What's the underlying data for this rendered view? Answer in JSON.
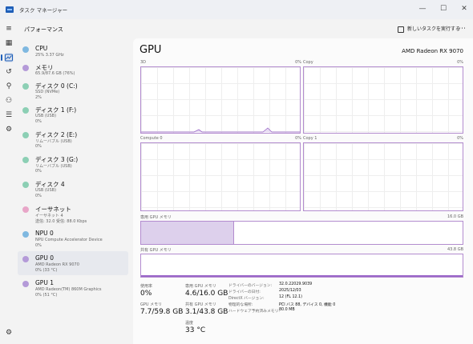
{
  "window": {
    "title": "タスク マネージャー",
    "controls": [
      "—",
      "☐",
      "✕"
    ]
  },
  "header": {
    "page_title": "パフォーマンス",
    "run_task_label": "新しいタスクを実行する",
    "more_label": "⋯"
  },
  "devices": [
    {
      "name": "CPU",
      "s1": "25%  3.37 GHz",
      "s2": "",
      "color": "#7fb8e0"
    },
    {
      "name": "メモリ",
      "s1": "65.9/87.6 GB (76%)",
      "s2": "",
      "color": "#b49ad8"
    },
    {
      "name": "ディスク 0 (C:)",
      "s1": "SSD (NVMe)",
      "s2": "2%",
      "color": "#8ccfb4"
    },
    {
      "name": "ディスク 1 (F:)",
      "s1": "USB (USB)",
      "s2": "0%",
      "color": "#8ccfb4"
    },
    {
      "name": "ディスク 2 (E:)",
      "s1": "リムーバブル (USB)",
      "s2": "0%",
      "color": "#8ccfb4"
    },
    {
      "name": "ディスク 3 (G:)",
      "s1": "リムーバブル (USB)",
      "s2": "0%",
      "color": "#8ccfb4"
    },
    {
      "name": "ディスク 4",
      "s1": "USB (USB)",
      "s2": "0%",
      "color": "#8ccfb4"
    },
    {
      "name": "イーサネット",
      "s1": "イーサネット 4",
      "s2": "送信: 32.0 受信: 88.0 Kbps",
      "color": "#e8a6c8"
    },
    {
      "name": "NPU 0",
      "s1": "NPU Compute Accelerator Device",
      "s2": "0%",
      "color": "#7fb8e0"
    },
    {
      "name": "GPU 0",
      "s1": "AMD Radeon RX 9070",
      "s2": "0% (33 °C)",
      "color": "#b49ad8"
    },
    {
      "name": "GPU 1",
      "s1": "AMD Radeon(TM) 860M Graphics",
      "s2": "0% (51 °C)",
      "color": "#b49ad8"
    }
  ],
  "gpu": {
    "title": "GPU",
    "model": "AMD Radeon RX 9070",
    "graphs": [
      {
        "label": "3D",
        "value": "0%"
      },
      {
        "label": "Copy",
        "value": "0%"
      },
      {
        "label": "Compute 0",
        "value": "0%"
      },
      {
        "label": "Copy 1",
        "value": "0%"
      }
    ],
    "dedicated": {
      "label": "専用 GPU メモリ",
      "max": "16.0 GB",
      "fraction": 0.29
    },
    "shared": {
      "label": "共有 GPU メモリ",
      "max": "43.8 GB",
      "fraction": 0.07
    },
    "stats": {
      "usage_label": "使用率",
      "usage_value": "0%",
      "gpumem_label": "GPU メモリ",
      "gpumem_value": "7.7/59.8 GB",
      "ded_label": "専用 GPU メモリ",
      "ded_value": "4.6/16.0 GB",
      "shared_label": "共有 GPU メモリ",
      "shared_value": "3.1/43.8 GB",
      "temp_label": "温度",
      "temp_value": "33 °C"
    },
    "info": [
      {
        "label": "ドライバーのバージョン:",
        "value": "32.0.22029.9039"
      },
      {
        "label": "ドライバーの日付:",
        "value": "2025/12/03"
      },
      {
        "label": "DirectX バージョン:",
        "value": "12 (FL 12.1)"
      },
      {
        "label": "物理的な場所:",
        "value": "PCI バス 88, デバイス 0, 機能 0"
      },
      {
        "label": "ハードウェア予約済みメモリ:",
        "value": "80.0 MB"
      }
    ]
  },
  "rail_icons": [
    "menu-icon",
    "processes-icon",
    "performance-icon",
    "app-history-icon",
    "startup-icon",
    "users-icon",
    "details-icon",
    "services-icon",
    "settings-icon"
  ]
}
